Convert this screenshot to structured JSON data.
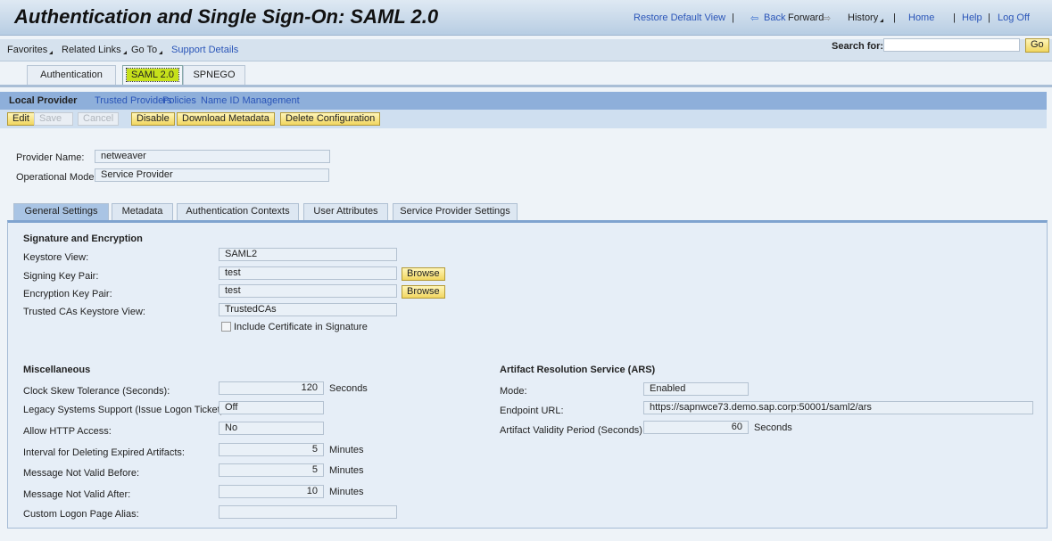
{
  "header": {
    "title": "Authentication and Single Sign-On: SAML 2.0",
    "restore": "Restore Default View",
    "back": "Back",
    "forward": "Forward",
    "history": "History",
    "home": "Home",
    "help": "Help",
    "logoff": "Log Off",
    "sep": "|"
  },
  "toolbar": {
    "favorites": "Favorites",
    "related": "Related Links",
    "goto": "Go To",
    "support": "Support Details",
    "search_label": "Search for:",
    "search_value": "",
    "go": "Go"
  },
  "top_tabs": [
    "Authentication",
    "SAML 2.0",
    "SPNEGO"
  ],
  "subnav": [
    "Local Provider",
    "Trusted Providers",
    "Policies",
    "Name ID Management"
  ],
  "buttons": {
    "edit": "Edit",
    "save": "Save",
    "cancel": "Cancel",
    "disable": "Disable",
    "download": "Download Metadata",
    "delete": "Delete Configuration"
  },
  "provider": {
    "name_label": "Provider Name:",
    "name": "netweaver",
    "mode_label": "Operational Mode:",
    "mode": "Service Provider"
  },
  "tabs": [
    "General Settings",
    "Metadata",
    "Authentication Contexts",
    "User Attributes",
    "Service Provider Settings"
  ],
  "sig": {
    "heading": "Signature and Encryption",
    "keystore_label": "Keystore View:",
    "keystore": "SAML2",
    "signing_label": "Signing Key Pair:",
    "signing": "test",
    "enc_label": "Encryption Key Pair:",
    "enc": "test",
    "trusted_label": "Trusted CAs Keystore View:",
    "trusted": "TrustedCAs",
    "browse": "Browse",
    "include_cert": "Include Certificate in Signature",
    "include_cert_checked": false
  },
  "misc": {
    "heading": "Miscellaneous",
    "clock_label": "Clock Skew Tolerance (Seconds):",
    "clock": "120",
    "seconds": "Seconds",
    "legacy_label": "Legacy Systems Support (Issue Logon Ticket):",
    "legacy": "Off",
    "http_label": "Allow HTTP Access:",
    "http": "No",
    "interval_label": "Interval for Deleting Expired Artifacts:",
    "interval": "5",
    "minutes": "Minutes",
    "before_label": "Message Not Valid Before:",
    "before": "5",
    "after_label": "Message Not Valid After:",
    "after": "10",
    "alias_label": "Custom Logon Page Alias:",
    "alias": ""
  },
  "ars": {
    "heading": "Artifact Resolution Service (ARS)",
    "mode_label": "Mode:",
    "mode": "Enabled",
    "url_label": "Endpoint URL:",
    "url": "https://sapnwce73.demo.sap.corp:50001/saml2/ars",
    "validity_label": "Artifact Validity Period (Seconds):",
    "validity": "60",
    "seconds": "Seconds"
  }
}
